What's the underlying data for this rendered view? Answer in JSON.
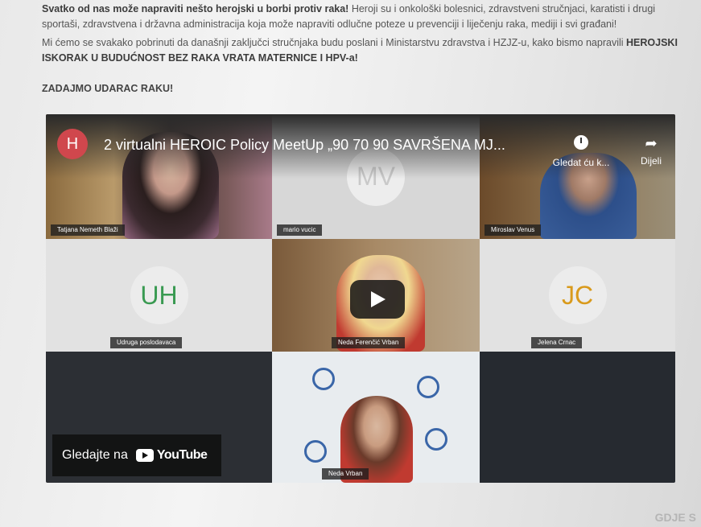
{
  "article": {
    "p1_bold": "Svatko od nas može napraviti nešto herojski u borbi protiv raka!",
    "p1_rest": "Heroji su i onkološki bolesnici, zdravstveni stručnjaci, karatisti i drugi sportaši, zdravstvena i državna administracija koja može napraviti odlučne poteze u prevenciji i liječenju raka, mediji i svi građani!",
    "p2_plain": "Mi ćemo se svakako pobrinuti da današnji zaključci stručnjaka budu poslani i Ministarstvu zdravstva i HZJZ-u, kako bismo napravili",
    "p2_bold": "HEROJSKI ISKORAK U BUDUĆNOST BEZ RAKA VRATA MATERNICE I HPV-a!",
    "p3": "ZADAJMO UDARAC RAKU!"
  },
  "video": {
    "channel_initial": "H",
    "title": "2 virtualni HEROIC Policy MeetUp „90 70 90 SAVRŠENA MJ...",
    "watch_later_label": "Gledat ću k...",
    "share_label": "Dijeli",
    "watch_on_label": "Gledajte na",
    "youtube_word": "YouTube",
    "participants": [
      {
        "name": "Tatjana Nemeth Blaži",
        "initials": ""
      },
      {
        "name": "mario vucic",
        "initials": "MV"
      },
      {
        "name": "Miroslav Venus",
        "initials": ""
      },
      {
        "name": "Udruga poslodavaca",
        "initials": "UH"
      },
      {
        "name": "Neda Ferenčić Vrban",
        "initials": ""
      },
      {
        "name": "Jelena Crnac",
        "initials": "JC"
      },
      {
        "name": "Neda Vrban",
        "initials": ""
      }
    ]
  },
  "corner_text": "GDJE S",
  "colors": {
    "uh": "#3a9a52",
    "jc": "#d99a1c",
    "mv": "#c9c9c9",
    "channel": "#d0474d"
  }
}
